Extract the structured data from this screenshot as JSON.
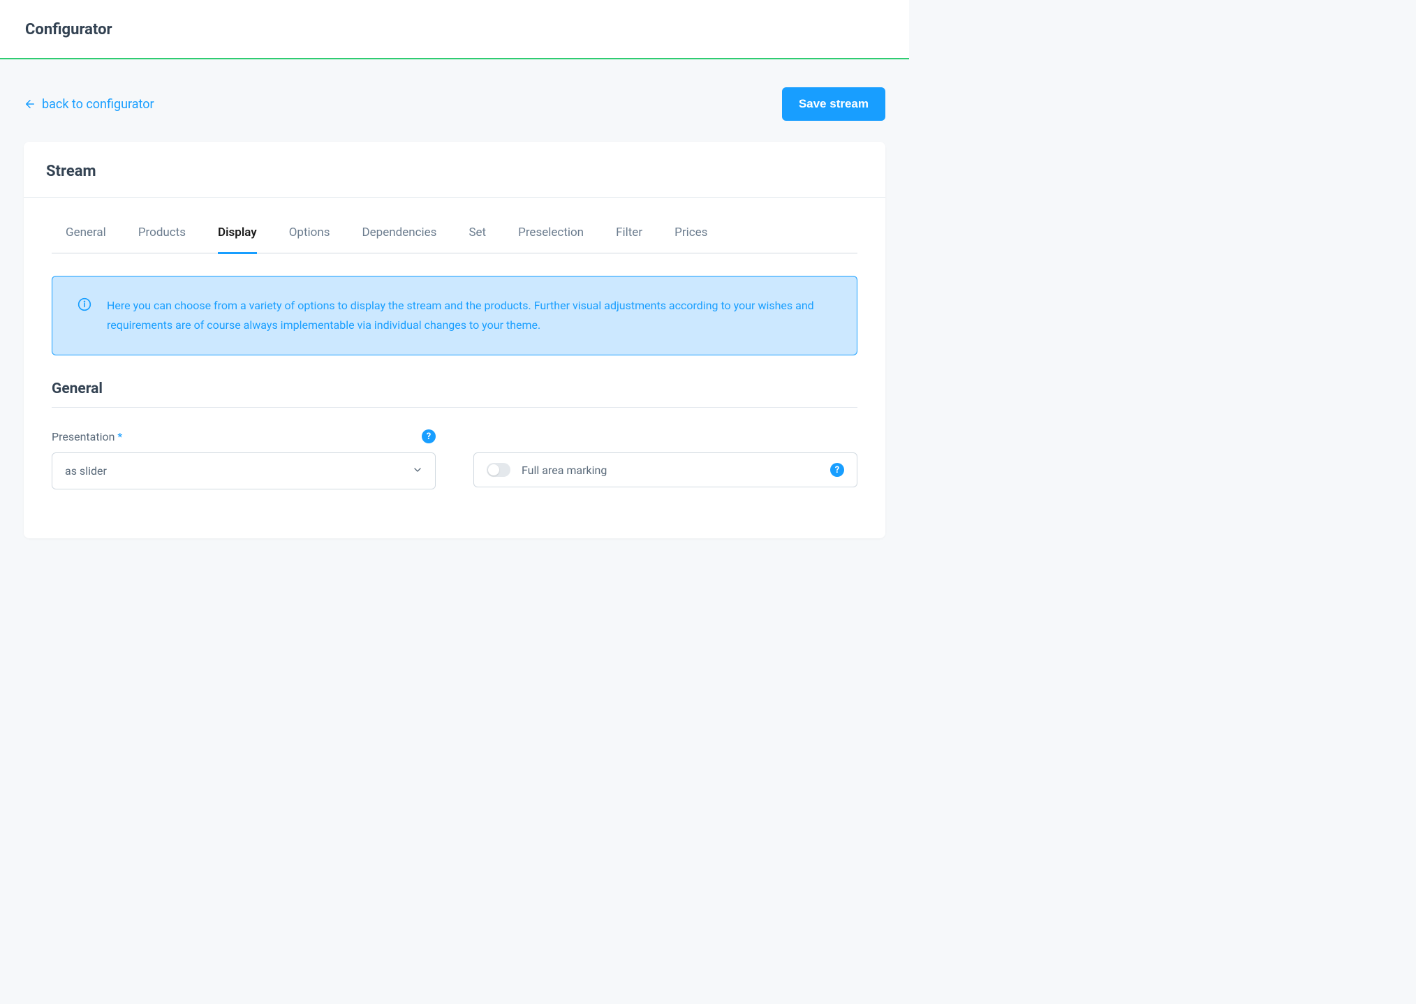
{
  "header": {
    "title": "Configurator"
  },
  "topbar": {
    "back_label": "back to configurator",
    "save_label": "Save stream"
  },
  "card": {
    "title": "Stream"
  },
  "tabs": [
    {
      "label": "General",
      "active": false
    },
    {
      "label": "Products",
      "active": false
    },
    {
      "label": "Display",
      "active": true
    },
    {
      "label": "Options",
      "active": false
    },
    {
      "label": "Dependencies",
      "active": false
    },
    {
      "label": "Set",
      "active": false
    },
    {
      "label": "Preselection",
      "active": false
    },
    {
      "label": "Filter",
      "active": false
    },
    {
      "label": "Prices",
      "active": false
    }
  ],
  "info": {
    "text": "Here you can choose from a variety of options to display the stream and the products. Further visual adjustments according to your wishes and requirements are of course always implementable via individual changes to your theme."
  },
  "section": {
    "title": "General"
  },
  "form": {
    "presentation": {
      "label": "Presentation",
      "required_marker": "*",
      "value": "as slider"
    },
    "full_area": {
      "label": "Full area marking"
    },
    "help_marker": "?"
  }
}
